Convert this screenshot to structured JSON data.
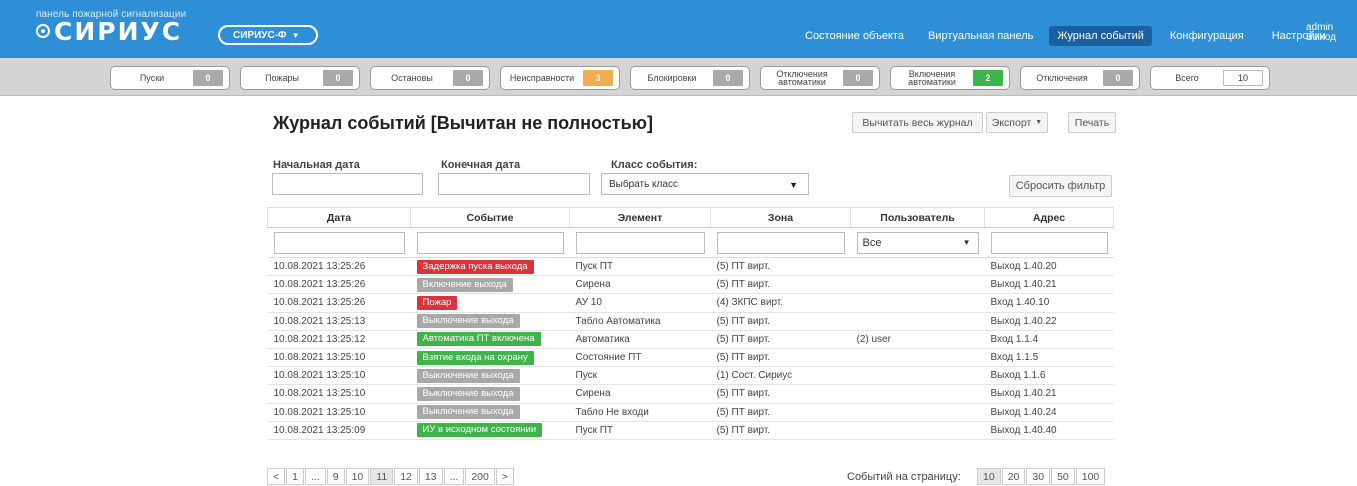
{
  "brand": {
    "subtitle": "панель пожарной сигнализации",
    "name": "СИРИУС"
  },
  "device": {
    "selected": "СИРИУС-Ф"
  },
  "nav": {
    "items": [
      "Состояние объекта",
      "Виртуальная панель",
      "Журнал событий",
      "Конфигурация",
      "Настройки"
    ],
    "active": "Журнал событий"
  },
  "user": {
    "name": "admin",
    "logout": "Выход"
  },
  "counters": [
    {
      "label": "Пуски",
      "value": "0",
      "color": "gray"
    },
    {
      "label": "Пожары",
      "value": "0",
      "color": "gray"
    },
    {
      "label": "Остановы",
      "value": "0",
      "color": "gray"
    },
    {
      "label": "Неисправности",
      "value": "3",
      "color": "orange"
    },
    {
      "label": "Блокировки",
      "value": "0",
      "color": "gray"
    },
    {
      "label": "Отключения\nавтоматики",
      "value": "0",
      "color": "gray"
    },
    {
      "label": "Включения\nавтоматики",
      "value": "2",
      "color": "green"
    },
    {
      "label": "Отключения",
      "value": "0",
      "color": "gray"
    },
    {
      "label": "Всего",
      "value": "10",
      "color": "white"
    }
  ],
  "page": {
    "title": "Журнал событий [Вычитан не полностью]"
  },
  "toolbar": {
    "read_all": "Вычитать весь журнал",
    "export": "Экспорт",
    "print": "Печать"
  },
  "filters": {
    "start_date_label": "Начальная дата",
    "end_date_label": "Конечная дата",
    "class_label": "Класс события:",
    "class_placeholder": "Выбрать класс",
    "reset": "Сбросить фильтр"
  },
  "table": {
    "columns": [
      "Дата",
      "Событие",
      "Элемент",
      "Зона",
      "Пользователь",
      "Адрес"
    ],
    "user_filter_value": "Все",
    "rows": [
      {
        "date": "10.08.2021  13:25:26",
        "event": "Задержка пуска выхода",
        "event_color": "red",
        "element": "Пуск ПТ",
        "zone": "(5) ПТ вирт.",
        "user": "",
        "address": "Выход 1.40.20"
      },
      {
        "date": "10.08.2021  13:25:26",
        "event": "Включение выхода",
        "event_color": "gray",
        "element": "Сирена",
        "zone": "(5) ПТ вирт.",
        "user": "",
        "address": "Выход 1.40.21"
      },
      {
        "date": "10.08.2021  13:25:26",
        "event": "Пожар",
        "event_color": "red",
        "element": "АУ 10",
        "zone": "(4) ЗКПС вирт.",
        "user": "",
        "address": "Вход 1.40.10"
      },
      {
        "date": "10.08.2021  13:25:13",
        "event": "Выключение выхода",
        "event_color": "gray",
        "element": "Табло Автоматика",
        "zone": "(5) ПТ вирт.",
        "user": "",
        "address": "Выход 1.40.22"
      },
      {
        "date": "10.08.2021  13:25:12",
        "event": "Автоматика ПТ включена",
        "event_color": "green",
        "element": "Автоматика",
        "zone": "(5) ПТ вирт.",
        "user": "(2) user",
        "address": "Вход 1.1.4"
      },
      {
        "date": "10.08.2021  13:25:10",
        "event": "Взятие входа на охрану",
        "event_color": "green",
        "element": "Состояние ПТ",
        "zone": "(5) ПТ вирт.",
        "user": "",
        "address": "Вход 1.1.5"
      },
      {
        "date": "10.08.2021  13:25:10",
        "event": "Выключение выхода",
        "event_color": "gray",
        "element": "Пуск",
        "zone": "(1) Сост. Сириус",
        "user": "",
        "address": "Выход 1.1.6"
      },
      {
        "date": "10.08.2021  13:25:10",
        "event": "Выключение выхода",
        "event_color": "gray",
        "element": "Сирена",
        "zone": "(5) ПТ вирт.",
        "user": "",
        "address": "Выход 1.40.21"
      },
      {
        "date": "10.08.2021  13:25:10",
        "event": "Выключение выхода",
        "event_color": "gray",
        "element": "Табло Не входи",
        "zone": "(5) ПТ вирт.",
        "user": "",
        "address": "Выход 1.40.24"
      },
      {
        "date": "10.08.2021  13:25:09",
        "event": "ИУ в исходном состоянии",
        "event_color": "green",
        "element": "Пуск ПТ",
        "zone": "(5) ПТ вирт.",
        "user": "",
        "address": "Выход 1.40.40"
      }
    ]
  },
  "pagination": {
    "pages": [
      "<",
      "1",
      "...",
      "9",
      "10",
      "11",
      "12",
      "13",
      "...",
      "200",
      ">"
    ],
    "current": "11",
    "per_page_label": "Событий на страницу:",
    "per_page_options": [
      "10",
      "20",
      "30",
      "50",
      "100"
    ],
    "per_page_selected": "10"
  }
}
